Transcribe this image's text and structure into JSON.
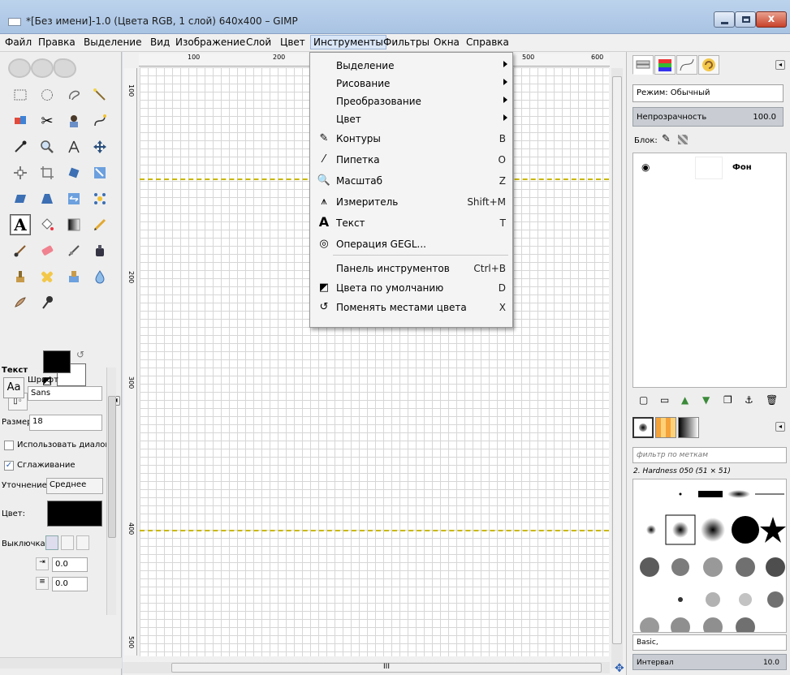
{
  "window": {
    "title": "*[Без имени]-1.0 (Цвета RGB, 1 слой) 640x400 – GIMP",
    "close_glyph": "x"
  },
  "menubar": {
    "items": [
      "Файл",
      "Правка",
      "Выделение",
      "Вид",
      "Изображение",
      "Слой",
      "Цвет",
      "Инструменты",
      "Фильтры",
      "Окна",
      "Справка"
    ],
    "active": "Инструменты"
  },
  "tools_menu": {
    "items": [
      {
        "label": "Выделение",
        "shortcut": "",
        "submenu": true,
        "icon": ""
      },
      {
        "label": "Рисование",
        "shortcut": "",
        "submenu": true,
        "icon": ""
      },
      {
        "label": "Преобразование",
        "shortcut": "",
        "submenu": true,
        "icon": ""
      },
      {
        "label": "Цвет",
        "shortcut": "",
        "submenu": true,
        "icon": ""
      },
      {
        "label": "Контуры",
        "shortcut": "B",
        "submenu": false,
        "icon": "paths-icon"
      },
      {
        "label": "Пипетка",
        "shortcut": "O",
        "submenu": false,
        "icon": "color-picker-icon"
      },
      {
        "label": "Масштаб",
        "shortcut": "Z",
        "submenu": false,
        "icon": "zoom-icon"
      },
      {
        "label": "Измеритель",
        "shortcut": "Shift+M",
        "submenu": false,
        "icon": "measure-icon"
      },
      {
        "label": "Текст",
        "shortcut": "T",
        "submenu": false,
        "icon": "text-icon"
      },
      {
        "label": "Операция GEGL...",
        "shortcut": "",
        "submenu": false,
        "icon": "gegl-icon"
      },
      {
        "label": "Панель инструментов",
        "shortcut": "Ctrl+B",
        "submenu": false,
        "icon": ""
      },
      {
        "label": "Цвета по умолчанию",
        "shortcut": "D",
        "submenu": false,
        "icon": "default-colors-icon"
      },
      {
        "label": "Поменять местами цвета",
        "shortcut": "X",
        "submenu": false,
        "icon": "swap-colors-icon"
      }
    ]
  },
  "rulers": {
    "h_ticks": [
      "100",
      "200",
      "500",
      "600"
    ],
    "v_ticks": [
      "100",
      "200",
      "300",
      "400",
      "500"
    ]
  },
  "tool_options": {
    "title": "Текст",
    "font_label": "Шрифт",
    "font_value": "Sans",
    "font_button": "Aa",
    "size_label": "Размер:",
    "size_value": "18",
    "use_editor_label": "Использовать диалог",
    "antialias_label": "Сглаживание",
    "hinting_label": "Уточнение:",
    "hinting_value": "Среднее",
    "color_label": "Цвет:",
    "justify_label": "Выключка:",
    "indent_value": "0.0",
    "line_spacing_value": "0.0"
  },
  "layers": {
    "mode_label": "Режим: Обычный",
    "opacity_label": "Непрозрачность",
    "opacity_value": "100.0",
    "lock_label": "Блок:",
    "layer_name": "Фон"
  },
  "brushes": {
    "filter_placeholder": "фильтр по меткам",
    "brush_name": "2. Hardness 050 (51 × 51)",
    "preset": "Basic,",
    "interval_label": "Интервал",
    "interval_value": "10.0"
  },
  "colors": {
    "foreground": "#000000",
    "background": "#ffffff",
    "guide": "#c9b800"
  }
}
